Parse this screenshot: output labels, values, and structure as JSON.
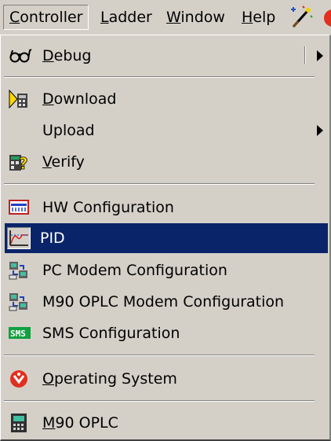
{
  "menubar": {
    "items": [
      {
        "label": "Controller",
        "mnemonic": "C",
        "rest": "ontroller"
      },
      {
        "label": "Ladder",
        "mnemonic": "L",
        "rest": "adder"
      },
      {
        "label": "Window",
        "mnemonic": "W",
        "rest": "indow"
      },
      {
        "label": "Help",
        "mnemonic": "H",
        "rest": "elp"
      }
    ],
    "icons": [
      "magic-wand-icon",
      "unitronics-logo-icon"
    ]
  },
  "menu": {
    "debug": {
      "pre": "",
      "mnemonic": "D",
      "rest": "ebug",
      "icon": "glasses-icon",
      "has_submenu": true
    },
    "download": {
      "pre": "",
      "mnemonic": "D",
      "rest": "ownload",
      "icon": "download-icon"
    },
    "upload": {
      "label": "Upload",
      "has_submenu": true
    },
    "verify": {
      "pre": "",
      "mnemonic": "V",
      "rest": "erify",
      "icon": "verify-icon"
    },
    "hw_configuration": {
      "label": "HW Configuration",
      "icon": "hw-config-icon"
    },
    "pid": {
      "label": "PID",
      "icon": "pid-graph-icon",
      "selected": true
    },
    "pc_modem": {
      "label": "PC Modem Configuration",
      "icon": "modem-icon"
    },
    "m90_modem": {
      "label": "M90 OPLC Modem Configuration",
      "icon": "modem-icon"
    },
    "sms": {
      "label": "SMS Configuration",
      "icon": "sms-icon"
    },
    "operating_system": {
      "pre": "",
      "mnemonic": "O",
      "rest": "perating System",
      "icon": "unitronics-logo-icon"
    },
    "m90_oplc": {
      "pre": "",
      "mnemonic": "M",
      "rest": "90 OPLC",
      "icon": "plc-device-icon"
    }
  },
  "colors": {
    "menu_bg": "#d4d0c8",
    "highlight": "#0a246a",
    "logo_red": "#e03020"
  }
}
